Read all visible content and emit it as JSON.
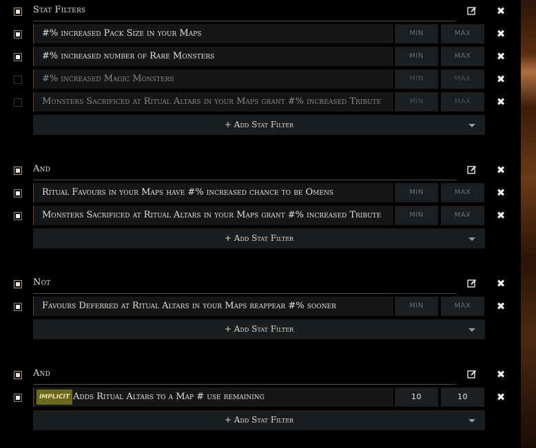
{
  "min_placeholder": "MIN",
  "max_placeholder": "MAX",
  "add_filter_label": "+ Add Stat Filter",
  "groups": [
    {
      "title": "Stat Filters",
      "enabled": true,
      "filters": [
        {
          "text": "#% increased Pack Size in your Maps",
          "enabled": true
        },
        {
          "text": "#% increased number of Rare Monsters",
          "enabled": true
        },
        {
          "text": "#% increased Magic Monsters",
          "enabled": false
        },
        {
          "text": "Monsters Sacrificed at Ritual Altars in your Maps grant #% increased Tribute",
          "enabled": false
        }
      ]
    },
    {
      "title": "And",
      "enabled": true,
      "filters": [
        {
          "text": "Ritual Favours in your Maps have #% increased chance to be Omens",
          "enabled": true
        },
        {
          "text": "Monsters Sacrificed at Ritual Altars in your Maps grant #% increased Tribute",
          "enabled": true
        }
      ]
    },
    {
      "title": "Not",
      "enabled": true,
      "filters": [
        {
          "text": "Favours Deferred at Ritual Altars in your Maps reappear #% sooner",
          "enabled": true
        }
      ]
    },
    {
      "title": "And",
      "enabled": true,
      "filters": [
        {
          "text": "Adds Ritual Altars to a Map # use remaining",
          "enabled": true,
          "badge": "implicit",
          "min": "10",
          "max": "10"
        }
      ]
    }
  ]
}
